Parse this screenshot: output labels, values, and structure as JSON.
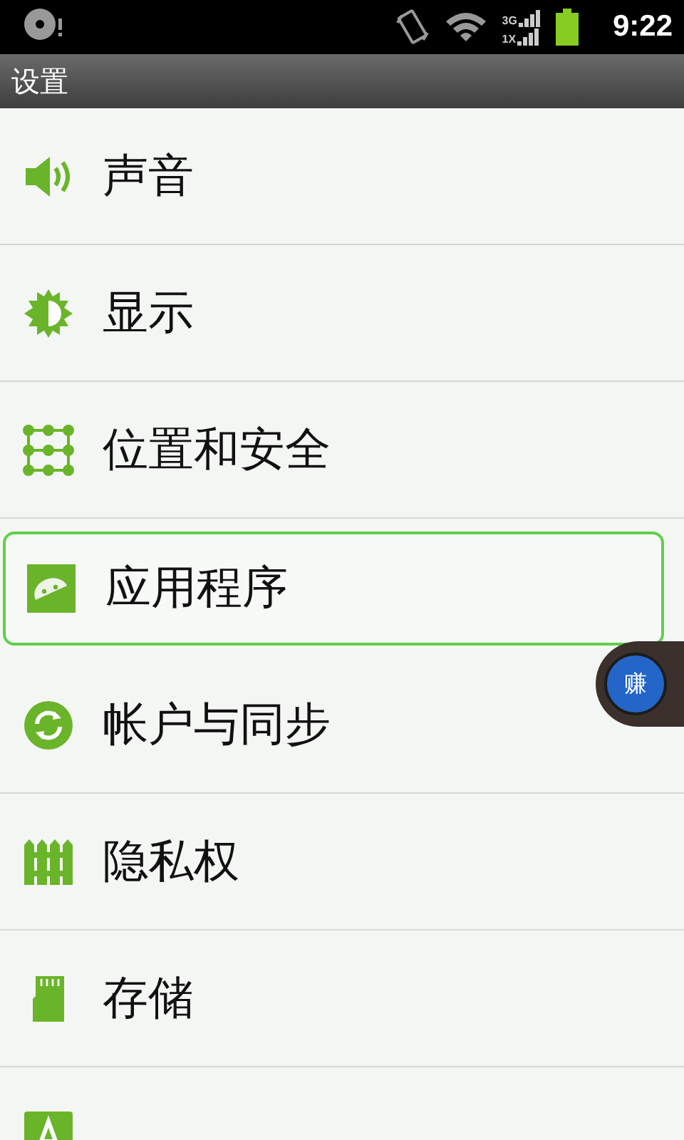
{
  "status_bar": {
    "network_labels": [
      "3G",
      "1X"
    ],
    "time": "9:22"
  },
  "title_bar": {
    "title": "设置"
  },
  "settings": [
    {
      "kind": "sound",
      "label": "声音",
      "selected": false
    },
    {
      "kind": "display",
      "label": "显示",
      "selected": false
    },
    {
      "kind": "location",
      "label": "位置和安全",
      "selected": false
    },
    {
      "kind": "apps",
      "label": "应用程序",
      "selected": true
    },
    {
      "kind": "sync",
      "label": "帐户与同步",
      "selected": false
    },
    {
      "kind": "privacy",
      "label": "隐私权",
      "selected": false
    },
    {
      "kind": "storage",
      "label": "存储",
      "selected": false
    },
    {
      "kind": "language",
      "selected": false
    }
  ],
  "floating_button": {
    "label": "赚"
  }
}
